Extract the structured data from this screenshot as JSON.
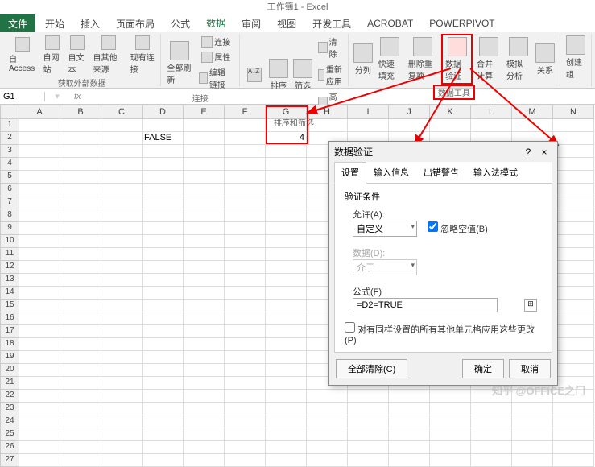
{
  "title": "工作簿1 - Excel",
  "menu": {
    "file": "文件",
    "tabs": [
      "开始",
      "插入",
      "页面布局",
      "公式",
      "数据",
      "审阅",
      "视图",
      "开发工具",
      "ACROBAT",
      "POWERPIVOT"
    ],
    "active": 4
  },
  "ribbon": {
    "g_external": {
      "label": "获取外部数据",
      "btns": [
        "自 Access",
        "自网站",
        "自文本",
        "自其他来源",
        "现有连接"
      ]
    },
    "g_conn": {
      "label": "连接",
      "refresh": "全部刷新",
      "items": [
        "连接",
        "属性",
        "编辑链接"
      ]
    },
    "g_sort": {
      "label": "排序和筛选",
      "sort": "排序",
      "filter": "筛选",
      "items": [
        "清除",
        "重新应用",
        "高级"
      ]
    },
    "g_tools": {
      "label": "数据工具",
      "btns": [
        "分列",
        "快速填充",
        "删除重复项",
        "数据验证",
        "合并计算",
        "模拟分析",
        "关系"
      ]
    },
    "g_outline": {
      "label": "",
      "btns": [
        "创建组"
      ]
    }
  },
  "namebox": "G1",
  "fx": "fx",
  "cols": [
    "A",
    "B",
    "C",
    "D",
    "E",
    "F",
    "G",
    "H",
    "I",
    "J",
    "K",
    "L",
    "M",
    "N"
  ],
  "rownums": [
    "1",
    "2",
    "3",
    "4",
    "5",
    "6",
    "7",
    "8",
    "9",
    "10",
    "11",
    "12",
    "13",
    "14",
    "15",
    "16",
    "17",
    "18",
    "19",
    "20",
    "21",
    "22",
    "23",
    "24",
    "25",
    "26",
    "27"
  ],
  "cells": {
    "D2": "FALSE",
    "G2": "4"
  },
  "dialog": {
    "title": "数据验证",
    "help": "?",
    "close": "×",
    "tabs": [
      "设置",
      "输入信息",
      "出错警告",
      "输入法模式"
    ],
    "section": "验证条件",
    "allow_label": "允许(A):",
    "allow_value": "自定义",
    "ignore_blank": "忽略空值(B)",
    "data_label": "数据(D):",
    "data_value": "介于",
    "formula_label": "公式(F)",
    "formula_value": "=D2=TRUE",
    "apply_all": "对有同样设置的所有其他单元格应用这些更改(P)",
    "clear": "全部清除(C)",
    "ok": "确定",
    "cancel": "取消"
  },
  "watermark": "知乎 @OFFICE之门"
}
